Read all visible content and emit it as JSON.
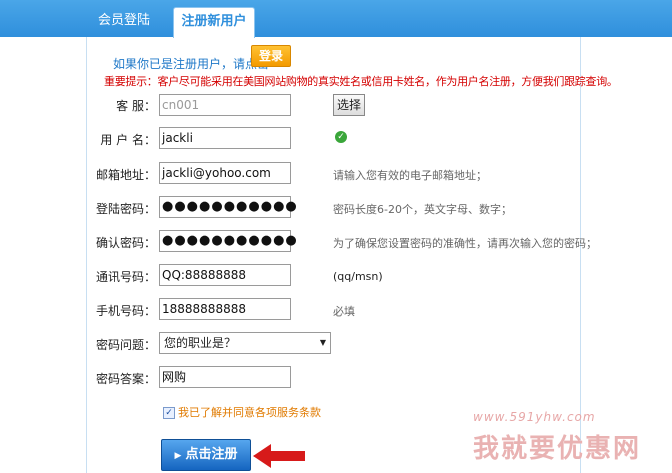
{
  "tabs": [
    {
      "label": "会员登陆"
    },
    {
      "label": "注册新用户"
    }
  ],
  "already_text": "如果你已是注册用户，请点击",
  "login_button": "登录",
  "notice": "重要提示：客户尽可能采用在美国网站购物的真实姓名或信用卡姓名，作为用户名注册，方便我们跟踪查询。",
  "fields": {
    "service": {
      "label": "客  服：",
      "placeholder": "cn001",
      "button": "选择"
    },
    "username": {
      "label": "用 户 名：",
      "value": "jackli"
    },
    "email": {
      "label": "邮箱地址：",
      "value": "jackli@yohoo.com",
      "hint": "请输入您有效的电子邮箱地址；"
    },
    "password": {
      "label": "登陆密码：",
      "value": "●●●●●●●●●●●",
      "hint": "密码长度6-20个，英文字母、数字；"
    },
    "confirm": {
      "label": "确认密码：",
      "value": "●●●●●●●●●●●",
      "hint": "为了确保您设置密码的准确性，请再次输入您的密码；"
    },
    "qq": {
      "label": "通讯号码：",
      "value": "QQ:88888888",
      "hint": "(qq/msn)"
    },
    "mobile": {
      "label": "手机号码：",
      "value": "18888888888",
      "hint": "必填"
    },
    "question": {
      "label": "密码问题：",
      "selected": "您的职业是？"
    },
    "answer": {
      "label": "密码答案：",
      "value": "网购"
    }
  },
  "agree_text": "我已了解并同意各项服务条款",
  "submit_label": "点击注册",
  "watermark_url": "www.591yhw.com",
  "watermark_name": "我就要优惠网",
  "colors": {
    "header_bg": "#2f8fdc",
    "notice": "#d40000",
    "accent_orange": "#f39a00"
  },
  "icons": {
    "username_status": "check-icon",
    "submit_arrow": "red-arrow-icon"
  }
}
